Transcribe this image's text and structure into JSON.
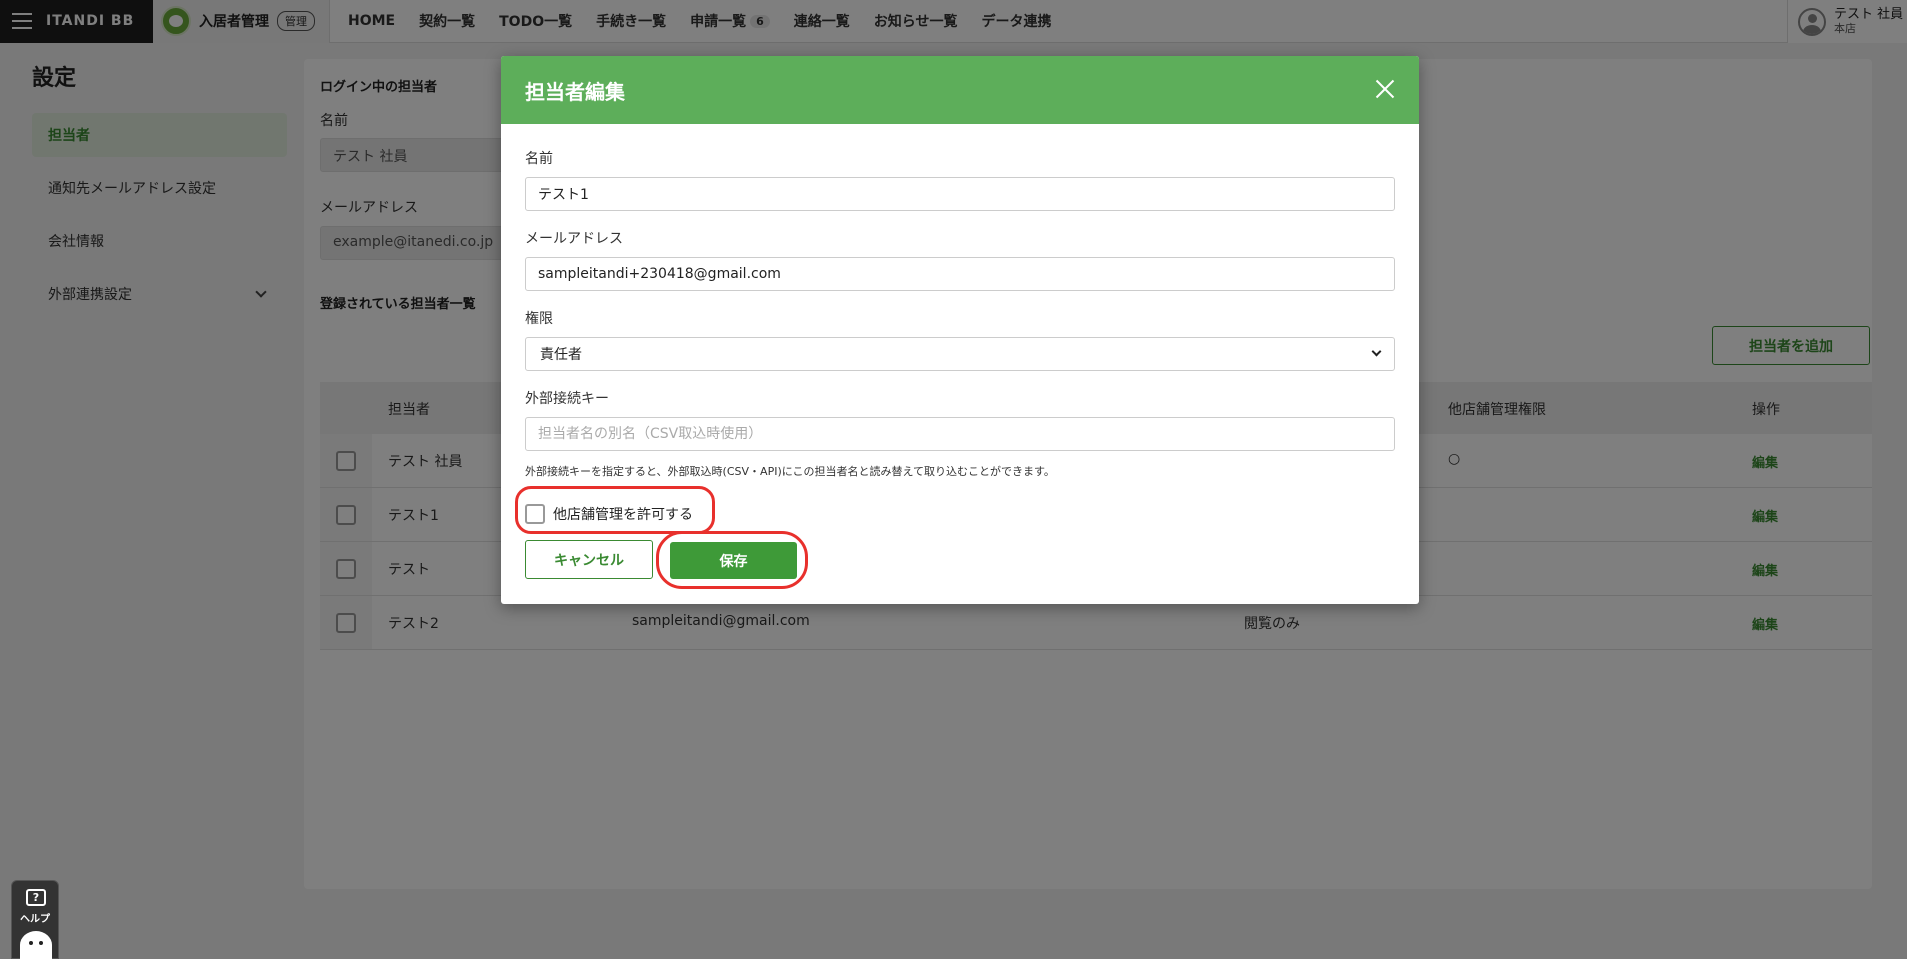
{
  "header": {
    "brand": "ITANDI BB",
    "product_name": "入居者管理",
    "product_badge": "管理",
    "nav": [
      {
        "label": "HOME"
      },
      {
        "label": "契約一覧"
      },
      {
        "label": "TODO一覧"
      },
      {
        "label": "手続き一覧"
      },
      {
        "label": "申請一覧",
        "count": "6"
      },
      {
        "label": "連絡一覧"
      },
      {
        "label": "お知らせ一覧"
      },
      {
        "label": "データ連携"
      }
    ],
    "user_name": "テスト 社員",
    "user_branch": "本店"
  },
  "page": {
    "title": "設定",
    "sidebar": [
      {
        "label": "担当者",
        "active": true
      },
      {
        "label": "通知先メールアドレス設定"
      },
      {
        "label": "会社情報"
      },
      {
        "label": "外部連携設定"
      }
    ]
  },
  "main": {
    "login_section_title": "ログイン中の担当者",
    "name_label": "名前",
    "name_value": "テスト 社員",
    "email_label": "メールアドレス",
    "email_value": "example@itanedi.co.jp",
    "list_title": "登録されている担当者一覧",
    "add_button": "担当者を追加",
    "table": {
      "headers": [
        "担当者",
        "他店舗管理権限",
        "操作"
      ],
      "rows": [
        {
          "name": "テスト 社員",
          "email": "",
          "role": "",
          "other_store": "○",
          "action": "編集"
        },
        {
          "name": "テスト1",
          "email": "",
          "role": "",
          "other_store": "",
          "action": "編集"
        },
        {
          "name": "テスト",
          "email": "",
          "role": "",
          "other_store": "",
          "action": "編集"
        },
        {
          "name": "テスト2",
          "email": "sampleitandi@gmail.com",
          "role": "閲覧のみ",
          "other_store": "",
          "action": "編集"
        }
      ]
    }
  },
  "help": {
    "icon": "?",
    "label": "ヘルプ"
  },
  "modal": {
    "title": "担当者編集",
    "name_label": "名前",
    "name_value": "テスト1",
    "email_label": "メールアドレス",
    "email_value": "sampleitandi+230418@gmail.com",
    "role_label": "権限",
    "role_value": "責任者",
    "external_key_label": "外部接続キー",
    "external_key_placeholder": "担当者名の別名（CSV取込時使用）",
    "external_key_help": "外部接続キーを指定すると、外部取込時(CSV・API)にこの担当者名と読み替えて取り込むことができます。",
    "allow_other_store_label": "他店舗管理を許可する",
    "allow_other_store_checked": false,
    "cancel_button": "キャンセル",
    "save_button": "保存"
  },
  "colors": {
    "accent_green": "#3e9a38",
    "modal_header_green": "#5dae5a",
    "highlight_red": "#e8302c"
  }
}
